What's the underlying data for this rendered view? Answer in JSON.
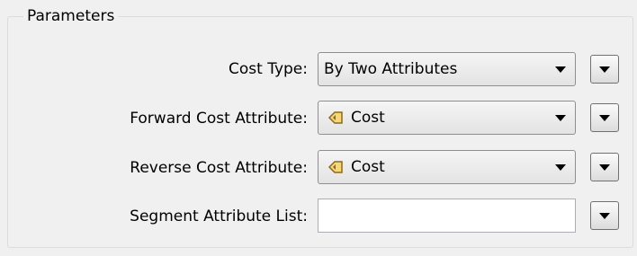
{
  "group": {
    "title": "Parameters"
  },
  "rows": [
    {
      "label": "Cost Type:",
      "value": "By Two Attributes",
      "icon": ""
    },
    {
      "label": "Forward Cost Attribute:",
      "value": "Cost",
      "icon": "attribute-tag-icon"
    },
    {
      "label": "Reverse Cost Attribute:",
      "value": "Cost",
      "icon": "attribute-tag-icon"
    },
    {
      "label": "Segment Attribute List:",
      "value": "",
      "icon": ""
    }
  ],
  "colors": {
    "panel_bg": "#f0f0f0",
    "icon_fill": "#f5d77a",
    "icon_stroke": "#8a6a20"
  }
}
